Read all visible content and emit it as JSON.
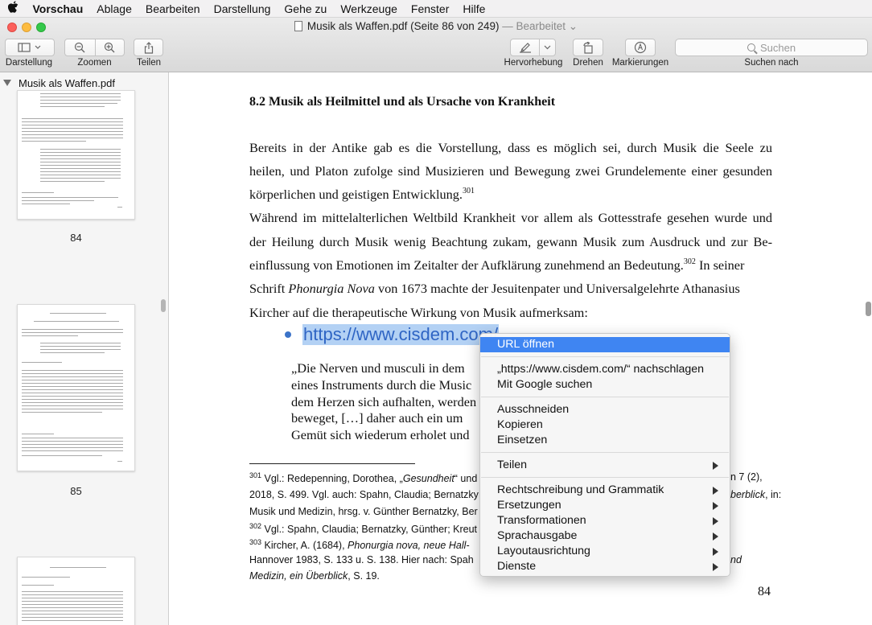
{
  "menubar": {
    "app_name": "Vorschau",
    "items": [
      "Ablage",
      "Bearbeiten",
      "Darstellung",
      "Gehe zu",
      "Werkzeuge",
      "Fenster",
      "Hilfe"
    ]
  },
  "window": {
    "title": "Musik als Waffen.pdf (Seite 86 von 249)",
    "edited_label": "— Bearbeitet ⌄"
  },
  "toolbar": {
    "view_label": "Darstellung",
    "zoom_label": "Zoomen",
    "share_label": "Teilen",
    "highlight_label": "Hervorhebung",
    "rotate_label": "Drehen",
    "markup_label": "Markierungen",
    "search_placeholder": "Suchen",
    "search_label": "Suchen nach",
    "icons": [
      "sidebar-icon",
      "zoom-out-icon",
      "zoom-in-icon",
      "share-icon",
      "highlight-pen-icon",
      "rotate-icon",
      "markup-icon",
      "search-icon"
    ]
  },
  "sidebar": {
    "file_name": "Musik als Waffen.pdf",
    "page_numbers": [
      "84",
      "85"
    ]
  },
  "document": {
    "heading": "8.2 Musik als Heilmittel und als Ursache von Krankheit",
    "para_lines": [
      "Bereits in der Antike gab es die Vorstellung, dass es möglich sei, durch Musik die Seele zu",
      "heilen, und Platon zufolge sind Musizieren und Bewegung zwei Grundelemente einer gesunden",
      "körperlichen und geistigen Entwicklung.",
      "Während im mittelalterlichen Weltbild Krankheit vor allem als Gottesstrafe gesehen wurde und",
      "der Heilung durch Musik wenig Beachtung zukam, gewann Musik zum Ausdruck und zur Be-",
      "einflussung von Emotionen im Zeitalter der Aufklärung zunehmend an Bedeutung.",
      " In seiner",
      "Schrift ",
      "Phonurgia Nova",
      " von 1673 machte der Jesuitenpater und Universalgelehrte Athanasius",
      "Kircher auf die therapeutische Wirkung von Musik aufmerksam:"
    ],
    "footnote_refs": [
      "301",
      "302"
    ],
    "bullet_url": "https://www.cisdem.com/",
    "quote_lines": [
      "„Die Nerven und musculi in dem",
      "eines Instruments durch die Music",
      "dem Herzen sich aufhalten, werden",
      "beweget, […] daher auch ein um",
      "Gemüt sich wiederum erholet und"
    ],
    "footnotes": {
      "fn301_num": "301",
      "fn301_a": "Vgl.: Redepenning, Dorothea, „",
      "fn301_b": "Gesundheit",
      "fn301_c": "“ und",
      "fn301_d": "n 7 (2),",
      "fn301_line2a": "2018, S. 499. Vgl. auch: Spahn, Claudia; Bernatzky",
      "fn301_line2b": "berblick",
      "fn301_line2c": ", in:",
      "fn301_line3": "Musik und Medizin, hrsg. v. Günther Bernatzky, Ber",
      "fn302_num": "302",
      "fn302": "Vgl.: Spahn, Claudia; Bernatzky, Günther; Kreut",
      "fn303_num": "303",
      "fn303_a": "Kircher, A. (1684), ",
      "fn303_b": "Phonurgia nova, neue Hall-",
      "fn303_line2a": "Hannover 1983, S. 133 u. S. 138. Hier nach: Spah",
      "fn303_line2b": "nd",
      "fn303_line3": "Medizin, ein Überblick",
      "fn303_line3b": ", S. 19."
    },
    "page_number": "84"
  },
  "context_menu": {
    "items": [
      {
        "label": "URL öffnen",
        "highlighted": true
      },
      {
        "label": "„https://www.cisdem.com/“ nachschlagen"
      },
      {
        "label": "Mit Google suchen"
      },
      {
        "label": "Ausschneiden"
      },
      {
        "label": "Kopieren"
      },
      {
        "label": "Einsetzen"
      },
      {
        "label": "Teilen",
        "submenu": true
      },
      {
        "label": "Rechtschreibung und Grammatik",
        "submenu": true
      },
      {
        "label": "Ersetzungen",
        "submenu": true
      },
      {
        "label": "Transformationen",
        "submenu": true
      },
      {
        "label": "Sprachausgabe",
        "submenu": true
      },
      {
        "label": "Layoutausrichtung",
        "submenu": true
      },
      {
        "label": "Dienste",
        "submenu": true
      }
    ]
  },
  "colors": {
    "highlight": "#3f85f2",
    "selection": "#b3d1f4",
    "link": "#2f65c4"
  }
}
